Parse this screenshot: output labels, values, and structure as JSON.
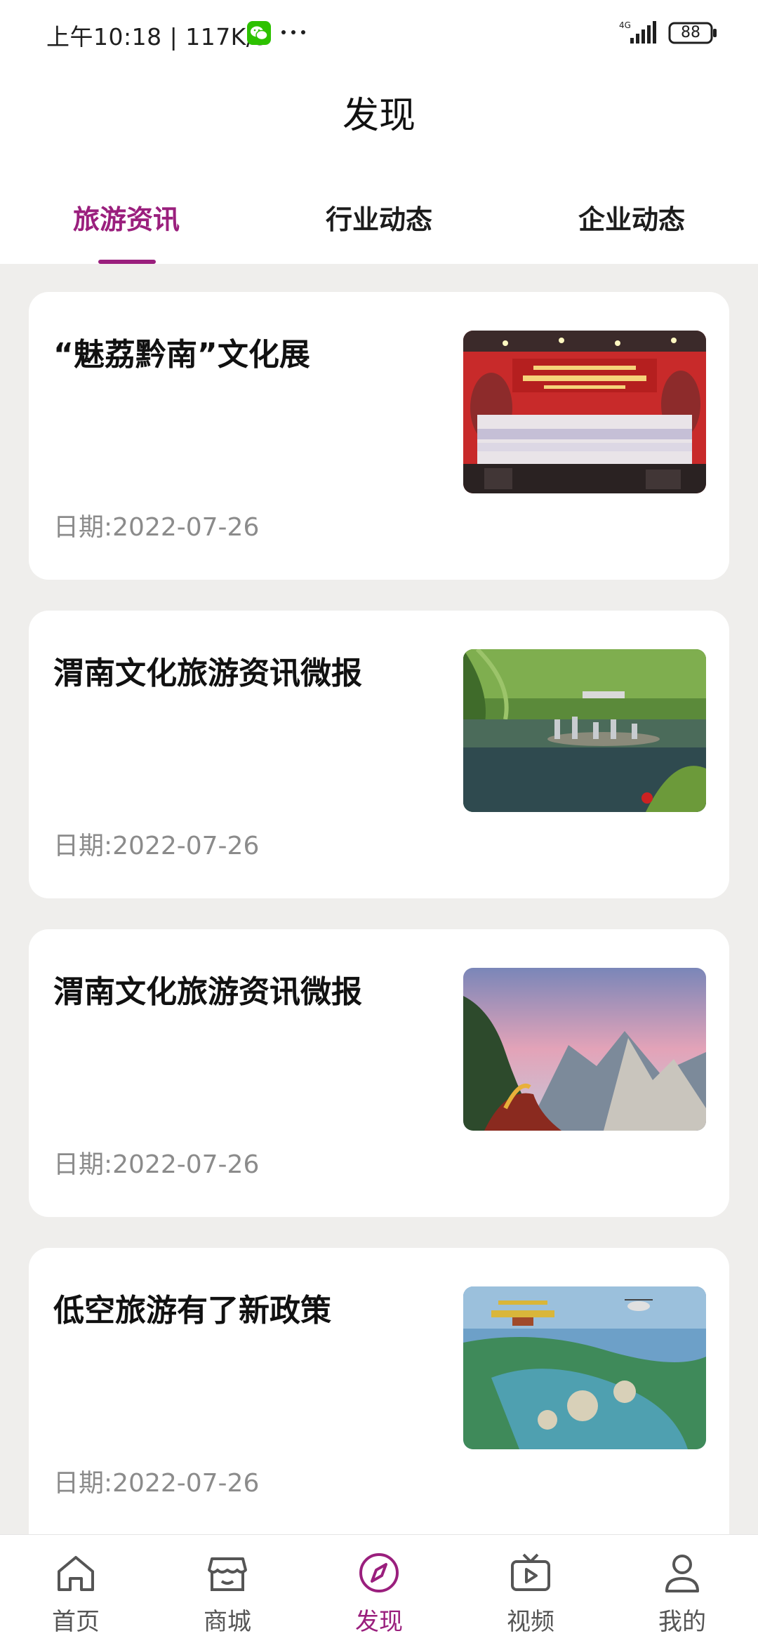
{
  "status_bar": {
    "time_speed": "上午10:18 | 117K/s",
    "network": "4G",
    "battery": "88"
  },
  "header": {
    "title": "发现",
    "tabs": [
      {
        "label": "旅游资讯",
        "active": true
      },
      {
        "label": "行业动态",
        "active": false
      },
      {
        "label": "企业动态",
        "active": false
      }
    ]
  },
  "articles": [
    {
      "title": "“魅荔黔南”文化展",
      "date": "日期:2022-07-26"
    },
    {
      "title": "渭南文化旅游资讯微报",
      "date": "日期:2022-07-26"
    },
    {
      "title": "渭南文化旅游资讯微报",
      "date": "日期:2022-07-26"
    },
    {
      "title": "低空旅游有了新政策",
      "date": "日期:2022-07-26"
    }
  ],
  "bottom_nav": [
    {
      "label": "首页",
      "icon": "home-icon"
    },
    {
      "label": "商城",
      "icon": "store-icon"
    },
    {
      "label": "发现",
      "icon": "compass-icon",
      "active": true
    },
    {
      "label": "视频",
      "icon": "video-icon"
    },
    {
      "label": "我的",
      "icon": "user-icon"
    }
  ],
  "colors": {
    "accent": "#9a1f7d",
    "background": "#efeeec"
  }
}
